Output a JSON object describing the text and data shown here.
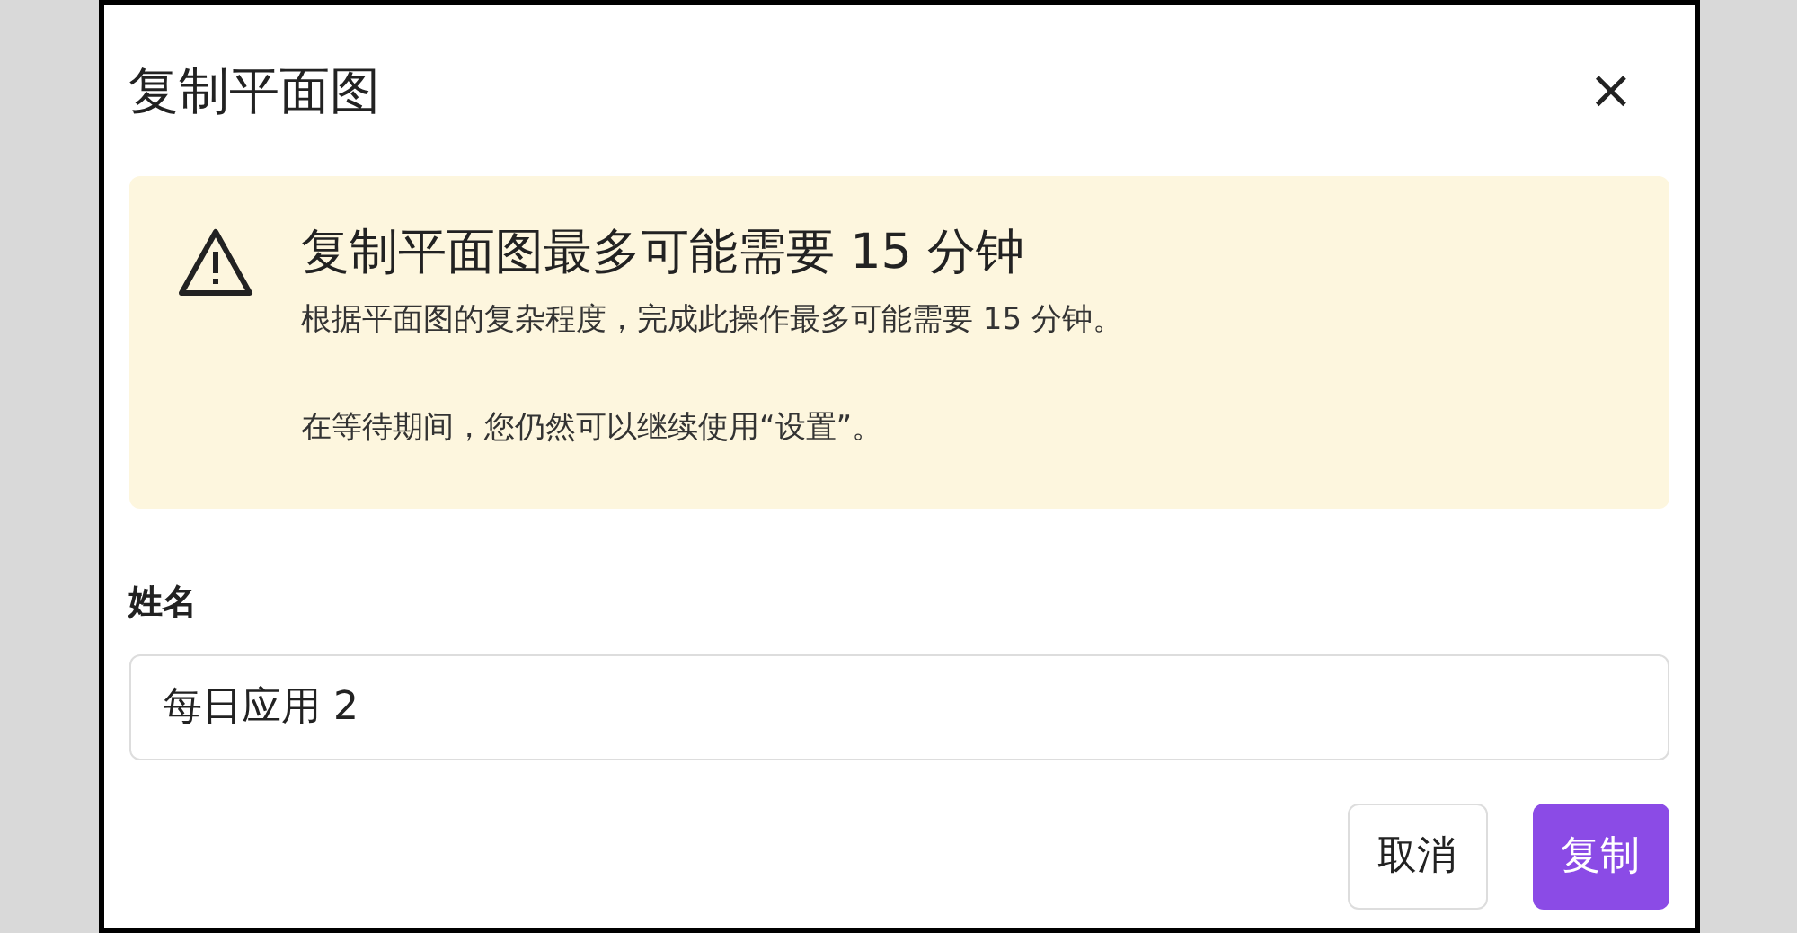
{
  "dialog": {
    "title": "复制平面图",
    "close_label": "×",
    "warning": {
      "heading": "复制平面图最多可能需要 15 分钟",
      "paragraphs": [
        "根据平面图的复杂程度，完成此操作最多可能需要 15 分钟。",
        "在等待期间，您仍然可以继续使用“设置”。"
      ]
    },
    "field": {
      "label": "姓名",
      "value": "每日应用 2"
    },
    "buttons": [
      {
        "label": "取消",
        "kind": "secondary"
      },
      {
        "label": "复制",
        "kind": "primary"
      }
    ]
  }
}
